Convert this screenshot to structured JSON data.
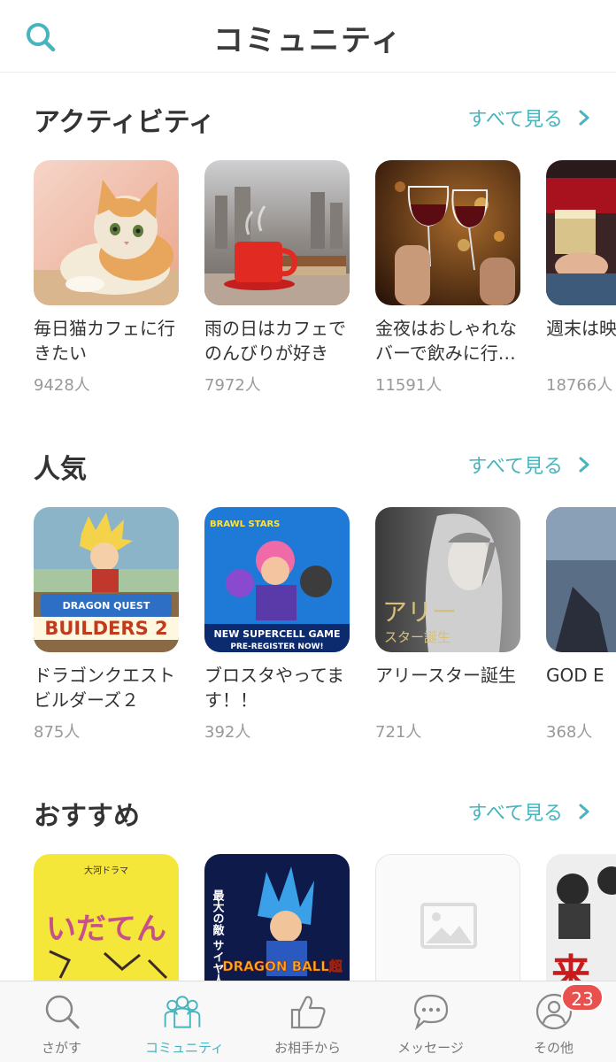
{
  "header": {
    "title": "コミュニティ"
  },
  "sections": [
    {
      "title": "アクティビティ",
      "see_all": "すべて見る",
      "cards": [
        {
          "name": "毎日猫カフェに行きたい",
          "count": "9428人"
        },
        {
          "name": "雨の日はカフェでのんびりが好き",
          "count": "7972人"
        },
        {
          "name": "金夜はおしゃれなバーで飲みに行…",
          "count": "11591人"
        },
        {
          "name": "週末は映画を観",
          "count": "18766人"
        }
      ]
    },
    {
      "title": "人気",
      "see_all": "すべて見る",
      "cards": [
        {
          "name": "ドラゴンクエストビルダーズ２",
          "count": "875人"
        },
        {
          "name": "ブロスタやってます！！",
          "count": "392人"
        },
        {
          "name": "アリースター誕生",
          "count": "721人"
        },
        {
          "name": "GOD E",
          "count": "368人"
        }
      ]
    },
    {
      "title": "おすすめ",
      "see_all": "すべて見る",
      "cards": [
        {
          "name": "",
          "count": ""
        },
        {
          "name": "",
          "count": ""
        },
        {
          "name": "",
          "count": ""
        },
        {
          "name": "",
          "count": ""
        }
      ]
    }
  ],
  "thumb_text": {
    "builders_top": "DRAGON QUEST",
    "builders": "BUILDERS 2",
    "brawl_logo": "BRAWL STARS",
    "brawl_banner_1": "NEW SUPERCELL GAME",
    "brawl_banner_2": "PRE-REGISTER NOW!",
    "ally_title": "アリー",
    "ally_sub": "スター誕生",
    "idaten_top": "大河ドラマ",
    "idaten": "いだてん",
    "dbs_side": "最大の敵 サイヤ人。",
    "dbs_logo": "DRAGON BALL超",
    "ki_char": "来"
  },
  "tabbar": {
    "tabs": [
      {
        "label": "さがす",
        "icon": "search-icon"
      },
      {
        "label": "コミュニティ",
        "icon": "community-icon"
      },
      {
        "label": "お相手から",
        "icon": "thumbs-up-icon"
      },
      {
        "label": "メッセージ",
        "icon": "message-icon"
      },
      {
        "label": "その他",
        "icon": "profile-icon"
      }
    ],
    "badge": "23"
  },
  "colors": {
    "accent": "#47b4be",
    "badge": "#e9514e",
    "text": "#333333",
    "muted": "#999999"
  }
}
